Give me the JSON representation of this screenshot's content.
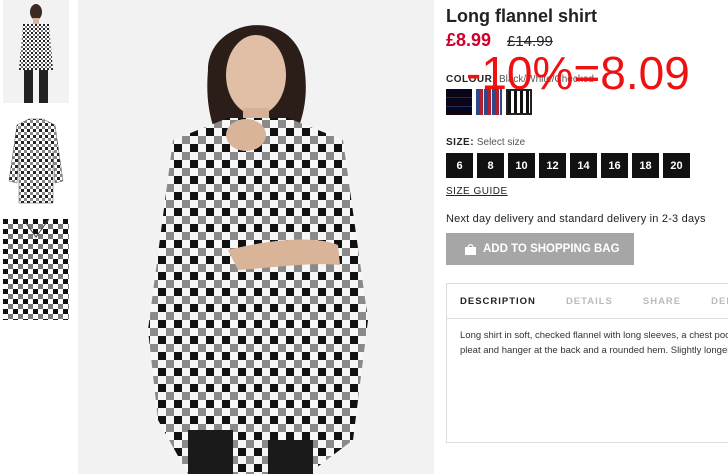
{
  "product": {
    "title": "Long flannel shirt",
    "price": "£8.99",
    "old_price": "£14.99",
    "discount_overlay": "-10%=8.09"
  },
  "colour": {
    "label": "COLOUR:",
    "value": "Black/White/Checked"
  },
  "size": {
    "label": "SIZE:",
    "value": "Select size",
    "options": [
      "6",
      "8",
      "10",
      "12",
      "14",
      "16",
      "18",
      "20"
    ],
    "guide_label": "SIZE GUIDE"
  },
  "delivery_text": "Next day delivery and standard delivery in 2-3 days",
  "bag_button_label": "ADD TO SHOPPING BAG",
  "tabs": [
    {
      "label": "DESCRIPTION"
    },
    {
      "label": "DETAILS"
    },
    {
      "label": "SHARE"
    },
    {
      "label": "DELIVERY"
    }
  ],
  "description": {
    "line1": "Long shirt in soft, checked flannel with long sleeves, a chest pocket,",
    "line2": "pleat and hanger at the back and a rounded hem. Slightly longer"
  },
  "colors": {
    "price_red": "#d0002a",
    "overlay_red": "#ee1111",
    "size_button_bg": "#111111",
    "bag_button_bg": "#a6a6a6"
  }
}
